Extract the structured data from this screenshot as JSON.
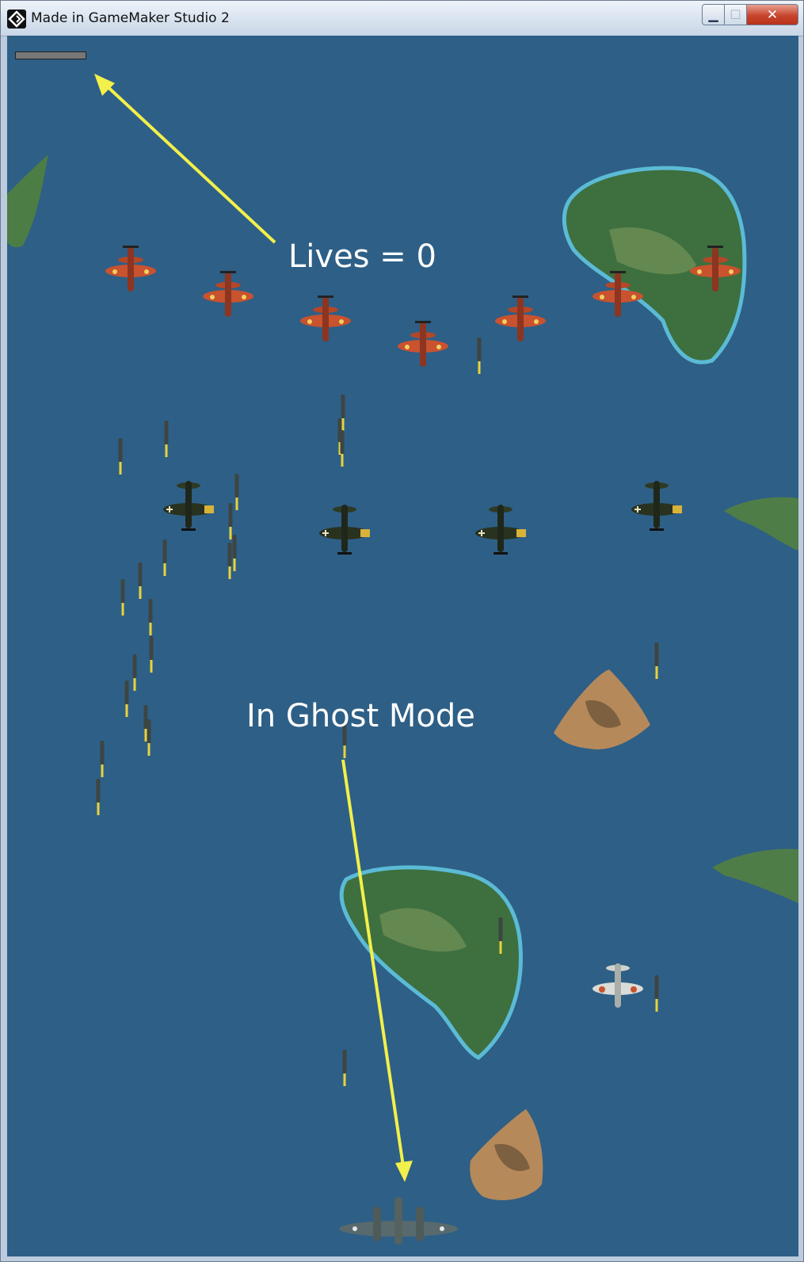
{
  "window": {
    "title": "Made in GameMaker Studio 2",
    "app_icon": "gamemaker-icon",
    "controls": {
      "minimize": "minimize-icon",
      "maximize": "maximize-icon",
      "close": "close-icon"
    }
  },
  "game": {
    "hud": {
      "lives_bar_fill": 0
    },
    "annotations": {
      "lives": "Lives = 0",
      "ghost_mode": "In Ghost Mode",
      "arrow_color": "#f2f04a"
    },
    "colors": {
      "sea": "#2e5f86",
      "red_plane": "#c9522f",
      "dark_plane": "#28321f",
      "player_plane": "#5d6b6a"
    }
  }
}
